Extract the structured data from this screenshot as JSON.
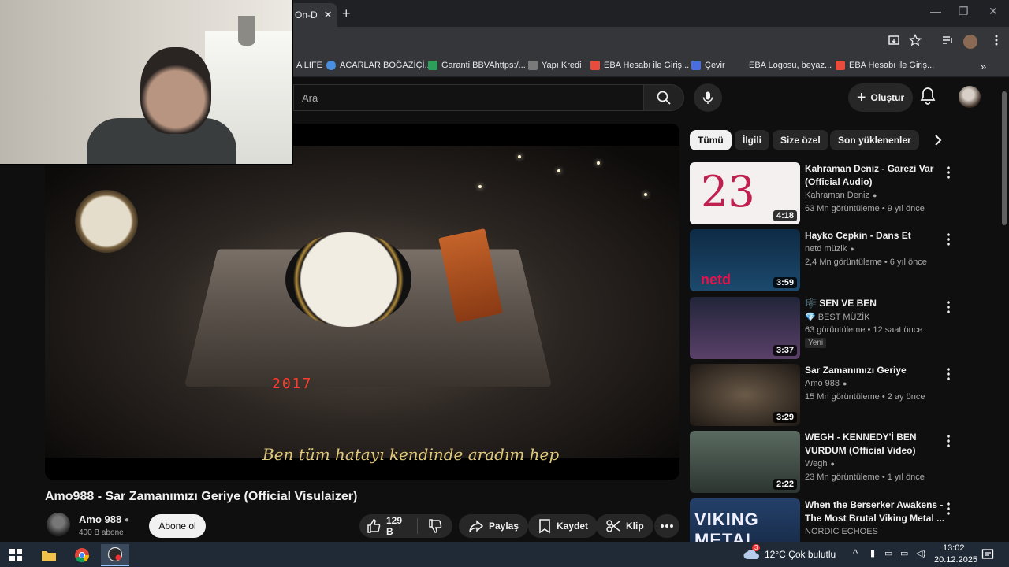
{
  "browser": {
    "active_tab_label": "On-D",
    "new_tab": "+",
    "window_controls": {
      "minimize": "—",
      "maximize": "❐",
      "close": "✕"
    }
  },
  "bookmarks": [
    {
      "label": "A LIFE",
      "color": "#f5a623"
    },
    {
      "label": "ACARLAR BOĞAZİÇİ...",
      "color": "#4a90e2"
    },
    {
      "label": "Garanti BBVAhttps:/...",
      "color": "#2e9e5b"
    },
    {
      "label": "Yapı Kredi",
      "color": "#7a7a7a"
    },
    {
      "label": "EBA Hesabı ile Giriş...",
      "color": "#e94b3c"
    },
    {
      "label": "Çevir",
      "color": "#4a6ee0"
    },
    {
      "label": "EBA Logosu, beyaz...",
      "color": "#35363a"
    },
    {
      "label": "EBA Hesabı ile Giriş...",
      "color": "#e94b3c"
    }
  ],
  "youtube": {
    "search_placeholder": "Ara",
    "create_label": "Oluştur"
  },
  "video": {
    "title": "Amo988 - Sar Zamanımızı Geriye (Official Visulaizer)",
    "led_text": "2017",
    "subtitle_text": "Ben tüm hatayı kendinde aradım hep",
    "channel_name": "Amo 988",
    "subscribers": "400 B abone",
    "subscribe_label": "Abone ol",
    "likes": "129 B",
    "share_label": "Paylaş",
    "save_label": "Kaydet",
    "clip_label": "Klip"
  },
  "chips": [
    "Tümü",
    "İlgili",
    "Size özel",
    "Son yüklenenler"
  ],
  "recommendations": [
    {
      "title": "Kahraman Deniz - Garezi Var (Official Audio)",
      "channel": "Kahraman Deniz",
      "meta": "63 Mn görüntüleme • 9 yıl önce",
      "duration": "4:18",
      "thumb_color": "#f4f0f0",
      "verified": true
    },
    {
      "title": "Hayko Cepkin - Dans Et",
      "channel": "netd müzik",
      "meta": "2,4 Mn görüntüleme • 6 yıl önce",
      "duration": "3:59",
      "thumb_color": "#0e2a44",
      "verified": true
    },
    {
      "title": "🎼 SEN VE BEN",
      "channel": "💎 BEST MÜZİK",
      "meta": "63 görüntüleme • 12 saat önce",
      "badge": "Yeni",
      "duration": "3:37",
      "thumb_color": "#3a3f58",
      "verified": false
    },
    {
      "title": "Sar Zamanımızı Geriye",
      "channel": "Amo 988",
      "meta": "15 Mn görüntüleme • 2 ay önce",
      "duration": "3:29",
      "thumb_color": "#3a3026",
      "verified": true
    },
    {
      "title": "WEGH - KENNEDY'İ BEN VURDUM (Official Video)",
      "channel": "Wegh",
      "meta": "23 Mn görüntüleme • 1 yıl önce",
      "duration": "2:22",
      "thumb_color": "#4c5a52",
      "verified": true
    },
    {
      "title": "When the Berserker Awakens - The Most Brutal Viking Metal ...",
      "channel": "NORDIC ECHOES",
      "meta": "",
      "duration": "",
      "thumb_color": "#24406a",
      "thumb_text": "VIKING METAL",
      "verified": false
    }
  ],
  "taskbar": {
    "weather": "12°C  Çok bulutlu",
    "time": "13:02",
    "date": "20.12.2025",
    "notification_count": "3"
  }
}
